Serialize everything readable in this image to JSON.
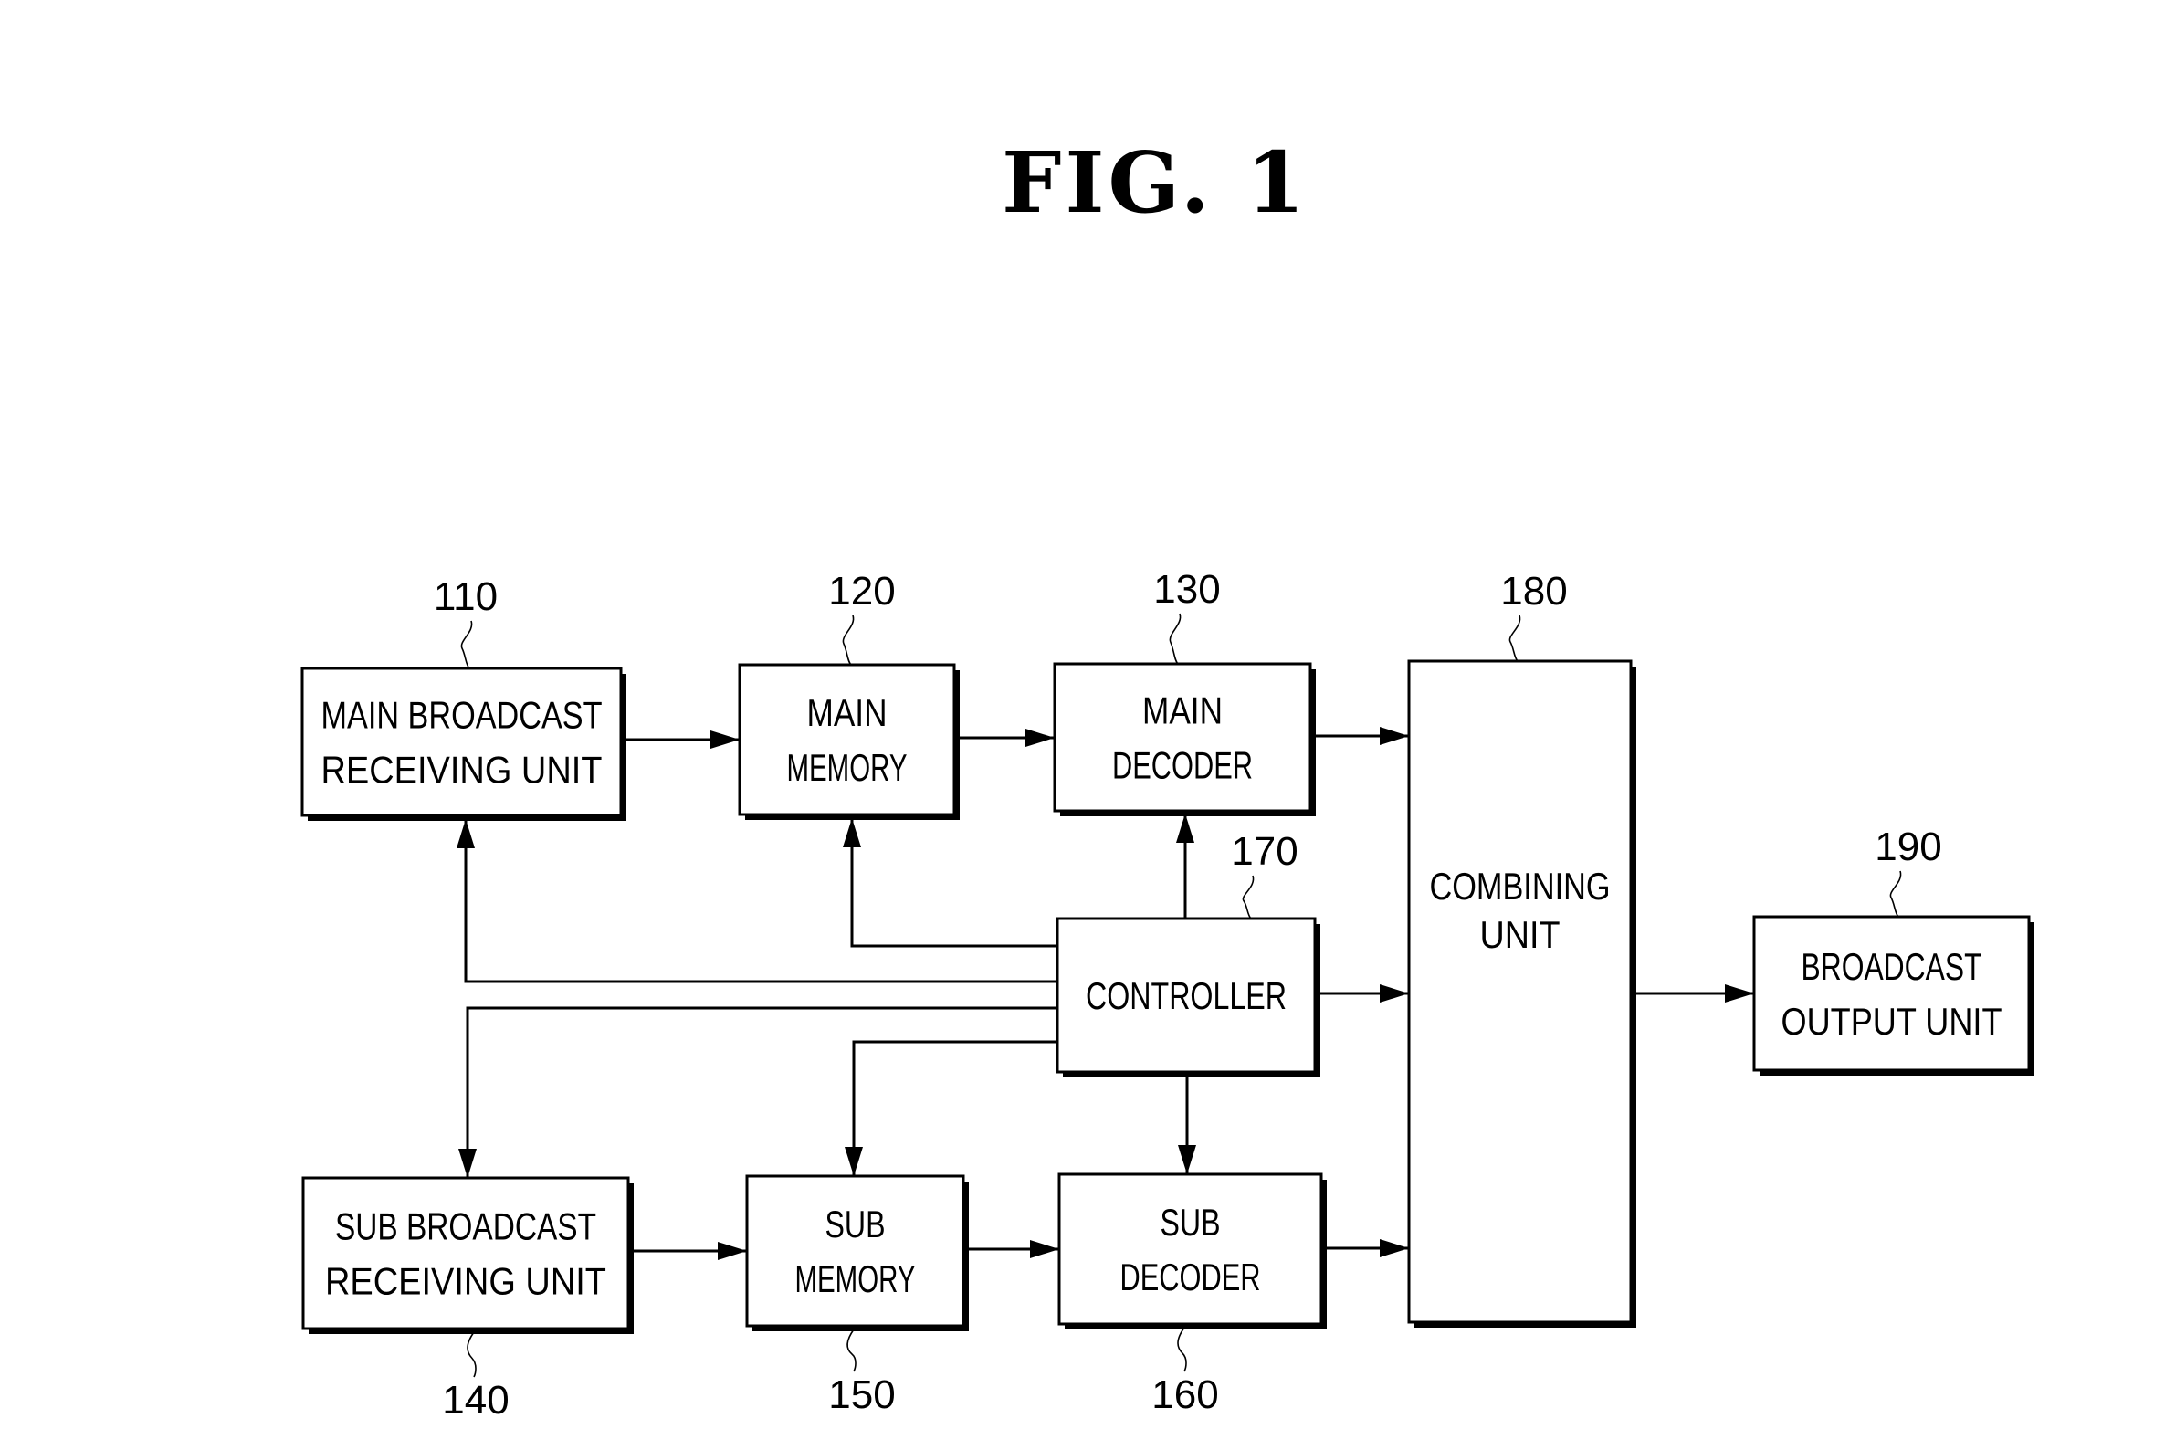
{
  "figure": {
    "title": "FIG.  1"
  },
  "blocks": [
    {
      "id": "110",
      "ref": "110",
      "lines": [
        "MAIN BROADCAST",
        "RECEIVING UNIT"
      ],
      "name": "main-broadcast-receiving-unit"
    },
    {
      "id": "120",
      "ref": "120",
      "lines": [
        "MAIN",
        "MEMORY"
      ],
      "name": "main-memory"
    },
    {
      "id": "130",
      "ref": "130",
      "lines": [
        "MAIN",
        "DECODER"
      ],
      "name": "main-decoder"
    },
    {
      "id": "140",
      "ref": "140",
      "lines": [
        "SUB BROADCAST",
        "RECEIVING UNIT"
      ],
      "name": "sub-broadcast-receiving-unit"
    },
    {
      "id": "150",
      "ref": "150",
      "lines": [
        "SUB",
        "MEMORY"
      ],
      "name": "sub-memory"
    },
    {
      "id": "160",
      "ref": "160",
      "lines": [
        "SUB",
        "DECODER"
      ],
      "name": "sub-decoder"
    },
    {
      "id": "170",
      "ref": "170",
      "lines": [
        "CONTROLLER"
      ],
      "name": "controller"
    },
    {
      "id": "180",
      "ref": "180",
      "lines": [
        "COMBINING",
        "UNIT"
      ],
      "name": "combining-unit"
    },
    {
      "id": "190",
      "ref": "190",
      "lines": [
        "BROADCAST",
        "OUTPUT UNIT"
      ],
      "name": "broadcast-output-unit"
    }
  ],
  "connections": [
    {
      "from": "110",
      "to": "120"
    },
    {
      "from": "120",
      "to": "130"
    },
    {
      "from": "130",
      "to": "180"
    },
    {
      "from": "140",
      "to": "150"
    },
    {
      "from": "150",
      "to": "160"
    },
    {
      "from": "160",
      "to": "180"
    },
    {
      "from": "170",
      "to": "110"
    },
    {
      "from": "170",
      "to": "120"
    },
    {
      "from": "170",
      "to": "130"
    },
    {
      "from": "170",
      "to": "140"
    },
    {
      "from": "170",
      "to": "150"
    },
    {
      "from": "170",
      "to": "160"
    },
    {
      "from": "170",
      "to": "180"
    },
    {
      "from": "180",
      "to": "190"
    }
  ]
}
